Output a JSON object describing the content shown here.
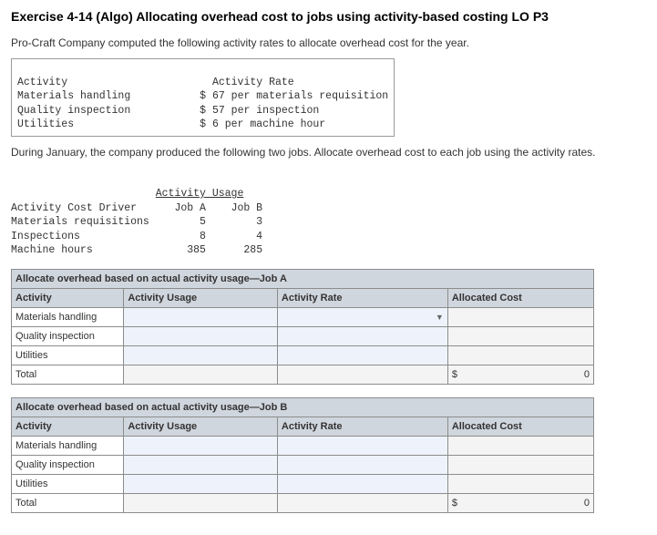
{
  "title": "Exercise 4-14 (Algo) Allocating overhead cost to jobs using activity-based costing LO P3",
  "intro": "Pro-Craft Company computed the following activity rates to allocate overhead cost for the year.",
  "rates": {
    "h_activity": "Activity",
    "h_rate": "Activity Rate",
    "rows": [
      {
        "name": "Materials handling",
        "rate": "$ 67 per materials requisition"
      },
      {
        "name": "Quality inspection",
        "rate": "$ 57 per inspection"
      },
      {
        "name": "Utilities",
        "rate": " $ 6 per machine hour"
      }
    ]
  },
  "mid": "During January, the company produced the following two jobs. Allocate overhead cost to each job using the activity rates.",
  "usage": {
    "h_group": "Activity Usage",
    "h_driver": "Activity Cost Driver",
    "h_a": "Job A",
    "h_b": "Job B",
    "rows": [
      {
        "driver": "Materials requisitions",
        "a": "5",
        "b": "3"
      },
      {
        "driver": "Inspections",
        "a": "8",
        "b": "4"
      },
      {
        "driver": "Machine hours",
        "a": "385",
        "b": "285"
      }
    ]
  },
  "ws": {
    "a_title": "Allocate overhead based on actual activity usage—Job A",
    "b_title": "Allocate overhead based on actual activity usage—Job B",
    "h_activity": "Activity",
    "h_usage": "Activity Usage",
    "h_rate": "Activity Rate",
    "h_cost": "Allocated Cost",
    "r1": "Materials handling",
    "r2": "Quality inspection",
    "r3": "Utilities",
    "r4": "Total",
    "currency": "$",
    "zero": "0"
  }
}
